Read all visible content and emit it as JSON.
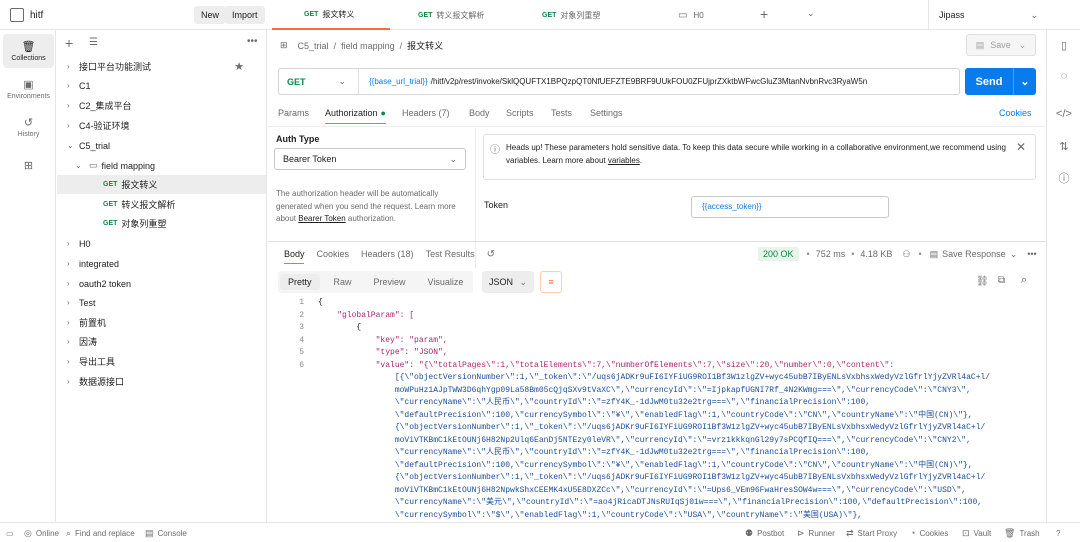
{
  "workspace": {
    "name": "hitf",
    "new_label": "New",
    "import_label": "Import"
  },
  "tabs": [
    {
      "method": "GET",
      "label": "报文转义",
      "active": true
    },
    {
      "method": "GET",
      "label": "转义报文解析"
    },
    {
      "method": "GET",
      "label": "对象列重塑"
    },
    {
      "method": "",
      "label": "H0"
    }
  ],
  "environment": {
    "selected": "Jipass"
  },
  "rail": [
    {
      "label": "Collections",
      "icon": "collections-icon"
    },
    {
      "label": "Environments",
      "icon": "environments-icon"
    },
    {
      "label": "History",
      "icon": "history-icon"
    },
    {
      "label": "",
      "icon": "apps-icon"
    }
  ],
  "sidebar": {
    "items": [
      {
        "label": "接口平台功能测试",
        "level": 0,
        "starred": true
      },
      {
        "label": "C1",
        "level": 0
      },
      {
        "label": "C2_集成平台",
        "level": 0
      },
      {
        "label": "C4-验证环境",
        "level": 0
      },
      {
        "label": "C5_trial",
        "level": 0,
        "expanded": true
      },
      {
        "label": "field mapping",
        "level": 1,
        "expanded": true,
        "folder": true
      },
      {
        "label": "报文转义",
        "level": 2,
        "method": "GET",
        "selected": true
      },
      {
        "label": "转义报文解析",
        "level": 2,
        "method": "GET"
      },
      {
        "label": "对象列重塑",
        "level": 2,
        "method": "GET"
      },
      {
        "label": "H0",
        "level": 0
      },
      {
        "label": "integrated",
        "level": 0
      },
      {
        "label": "oauth2 token",
        "level": 0
      },
      {
        "label": "Test",
        "level": 0
      },
      {
        "label": "前置机",
        "level": 0
      },
      {
        "label": "因涛",
        "level": 0
      },
      {
        "label": "导出工具",
        "level": 0
      },
      {
        "label": "数据源接口",
        "level": 0
      }
    ]
  },
  "breadcrumb": {
    "collection": "C5_trial",
    "folder": "field mapping",
    "request": "报文转义",
    "save_label": "Save"
  },
  "request": {
    "method": "GET",
    "url_var": "{{base_url_trial}}",
    "url_path": "/hitf/v2p/rest/invoke/SklQQUFTX1BPQzpQT0NfUEFZTE9BRF9UUkFOU0ZFUjprZXktbWFwcGluZ3MtanNvbnRvc3RyaW5n",
    "send_label": "Send"
  },
  "request_tabs": [
    "Params",
    "Authorization",
    "Headers (7)",
    "Body",
    "Scripts",
    "Tests",
    "Settings"
  ],
  "cookies_label": "Cookies",
  "auth": {
    "type_label": "Auth Type",
    "type_value": "Bearer Token",
    "help_text_1": "The authorization header will be automatically generated when you send the request. Learn more about ",
    "help_link": "Bearer Token",
    "help_text_2": " authorization.",
    "notice_text": "Heads up! These parameters hold sensitive data. To keep this data secure while working in a collaborative environment,we recommend using variables. Learn more about ",
    "notice_link": "variables",
    "notice_end": ".",
    "token_label": "Token",
    "token_value": "{{access_token}}"
  },
  "response": {
    "tabs": [
      "Body",
      "Cookies",
      "Headers (18)",
      "Test Results"
    ],
    "status": "200 OK",
    "time": "752 ms",
    "size": "4.18 KB",
    "save_response": "Save Response",
    "view_modes": [
      "Pretty",
      "Raw",
      "Preview",
      "Visualize"
    ],
    "format": "JSON"
  },
  "code_lines": [
    {
      "n": "1",
      "text": "{"
    },
    {
      "n": "2",
      "text": "    \"globalParam\": ["
    },
    {
      "n": "3",
      "text": "        {"
    },
    {
      "n": "4",
      "text": "            \"key\": \"param\","
    },
    {
      "n": "5",
      "text": "            \"type\": \"JSON\","
    },
    {
      "n": "6",
      "text": "            \"value\": \"{\\\"totalPages\\\":1,\\\"totalElements\\\":7,\\\"numberOfElements\\\":7,\\\"size\\\":20,\\\"number\\\":0,\\\"content\\\":"
    },
    {
      "n": "",
      "text": "                [{\\\"objectVersionNumber\\\":1,\\\"_token\\\":\\\"/uqs6jADKr9uFI6IYFiUG9ROI1Bf3W1zlgZV+wyc45ubB7IByENLsVxbhsxWedyVzlGfrlYjyZVRl4aC+l/"
    },
    {
      "n": "",
      "text": "                moWPuHz1AJpTWW3D6qhYgp09La58Bm05cQjqSXv9tVaXC\\\",\\\"currencyId\\\":\\\"=IjpkapfUGNI7Rf_4N2KWmg===\\\",\\\"currencyCode\\\":\\\"CNY3\\\","
    },
    {
      "n": "",
      "text": "                \\\"currencyName\\\":\\\"人民币\\\",\\\"countryId\\\":\\\"=zfY4K_-1dJwM0tu32e2trg===\\\",\\\"financialPrecision\\\":100,"
    },
    {
      "n": "",
      "text": "                \\\"defaultPrecision\\\":100,\\\"currencySymbol\\\":\\\"¥\\\",\\\"enabledFlag\\\":1,\\\"countryCode\\\":\\\"CN\\\",\\\"countryName\\\":\\\"中国(CN)\\\"},"
    },
    {
      "n": "",
      "text": "                {\\\"objectVersionNumber\\\":1,\\\"_token\\\":\\\"/uqs6jADKr9uFI6IYFiUG9ROI1Bf3W1zlgZV+wyc45ubB7IByENLsVxbhsxWedyVzlGfrlYjyZVRl4aC+l/"
    },
    {
      "n": "",
      "text": "                moViVTKBmC1kEtOUNj6H82Np2Ulq6EanDj5NTEzy0leVR\\\",\\\"currencyId\\\":\\\"=vrz1kkkqnGl29y7sPCQfIQ===\\\",\\\"currencyCode\\\":\\\"CNY2\\\","
    },
    {
      "n": "",
      "text": "                \\\"currencyName\\\":\\\"人民币\\\",\\\"countryId\\\":\\\"=zfY4K_-1dJwM0tu32e2trg===\\\",\\\"financialPrecision\\\":100,"
    },
    {
      "n": "",
      "text": "                \\\"defaultPrecision\\\":100,\\\"currencySymbol\\\":\\\"¥\\\",\\\"enabledFlag\\\":1,\\\"countryCode\\\":\\\"CN\\\",\\\"countryName\\\":\\\"中国(CN)\\\"},"
    },
    {
      "n": "",
      "text": "                {\\\"objectVersionNumber\\\":1,\\\"_token\\\":\\\"/uqs6jADKr9uFI6IYFiUG9ROI1Bf3W1zlgZV+wyc45ubB7IByENLsVxbhsxWedyVzlGfrlYjyZVRl4aC+l/"
    },
    {
      "n": "",
      "text": "                moViVTKBmC1kEtOUNj6H82NpwkShxCEEMK4xU5E8DXZCc\\\",\\\"currencyId\\\":\\\"=Ups6_VEm96FwaHresSOW4w===\\\",\\\"currencyCode\\\":\\\"USD\\\","
    },
    {
      "n": "",
      "text": "                \\\"currencyName\\\":\\\"美元\\\",\\\"countryId\\\":\\\"=ao4jRicaDTJNsRUIqSj01w===\\\",\\\"financialPrecision\\\":100,\\\"defaultPrecision\\\":100,"
    },
    {
      "n": "",
      "text": "                \\\"currencySymbol\\\":\\\"$\\\",\\\"enabledFlag\\\":1,\\\"countryCode\\\":\\\"USA\\\",\\\"countryName\\\":\\\"美国(USA)\\\"},"
    }
  ],
  "bottom_bar": {
    "online": "Online",
    "find_replace": "Find and replace",
    "console": "Console",
    "postbot": "Postbot",
    "runner": "Runner",
    "start_proxy": "Start Proxy",
    "cookies": "Cookies",
    "vault": "Vault",
    "trash": "Trash"
  },
  "colors": {
    "accent": "#ff6c37",
    "send": "#097bed",
    "get": "#0b8a47",
    "status_ok": "#0b8a47"
  }
}
